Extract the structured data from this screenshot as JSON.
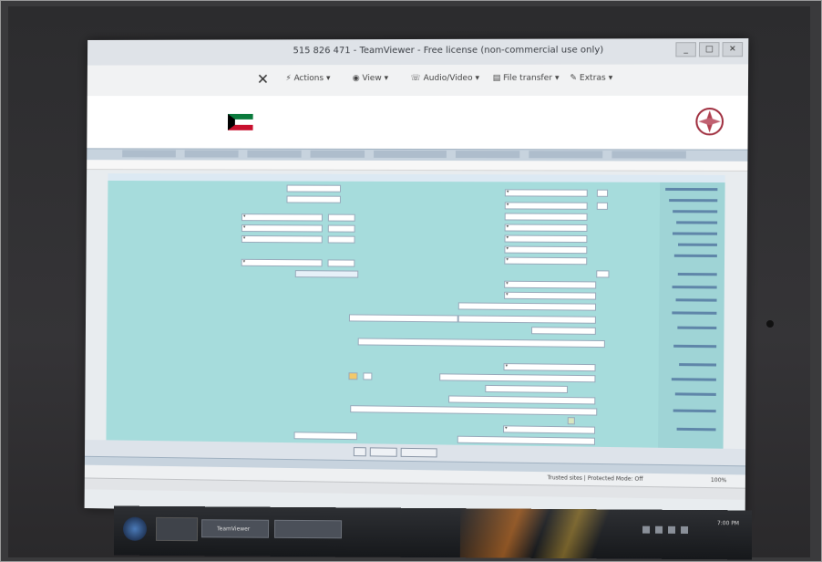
{
  "window": {
    "title": "515 826 471 - TeamViewer - Free license (non-commercial use only)"
  },
  "teamviewer_toolbar": {
    "close_label": "✕",
    "actions_label": "Actions",
    "view_label": "View",
    "audio_video_label": "Audio/Video",
    "file_transfer_label": "File transfer",
    "extras_label": "Extras"
  },
  "site": {
    "header_small_1": "",
    "header_small_2": ""
  },
  "form": {
    "field_values": {
      "value_1": "",
      "value_2": "",
      "value_3": ""
    }
  },
  "buttons": {
    "btn_1": "",
    "btn_2": "",
    "btn_3": ""
  },
  "status_bar": {
    "trust_text": "Trusted sites | Protected Mode: Off",
    "zoom_text": "100%"
  },
  "taskbar": {
    "window_1": "TeamViewer",
    "window_2": "",
    "clock_time": "7:00 PM",
    "clock_date": ""
  },
  "colors": {
    "form_background": "#a6dcdc",
    "labels_column": "#9fd4d6",
    "nav_bar": "#c7d3de",
    "bezel": "#2c2c2e"
  },
  "icons": [
    "close-icon",
    "actions-icon",
    "view-icon",
    "audio-video-icon",
    "file-transfer-icon",
    "extras-icon",
    "kuwait-flag-icon",
    "ministry-logo-icon",
    "windows-start-icon"
  ]
}
